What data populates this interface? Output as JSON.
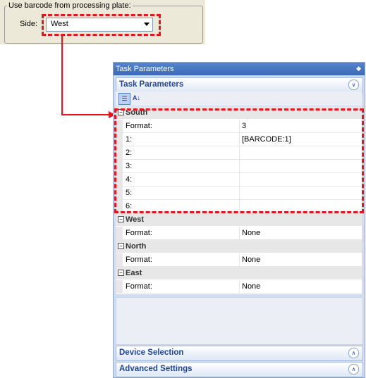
{
  "group": {
    "legend": "Use barcode from processing plate:",
    "side_label": "Side:",
    "side_value": "West"
  },
  "panel": {
    "title": "Task Parameters",
    "pin_icon": "pin-icon",
    "sections": {
      "task_parameters": "Task Parameters",
      "device_selection": "Device Selection",
      "advanced_settings": "Advanced Settings"
    },
    "toolbar": {
      "categorized_icon": "categorized-icon",
      "alphabetical_icon": "sort-alpha-icon"
    },
    "grid": {
      "categories": [
        {
          "name": "South",
          "rows": [
            {
              "key": "Format:",
              "value": "3"
            },
            {
              "key": "1:",
              "value": "[BARCODE:1]"
            },
            {
              "key": "2:",
              "value": ""
            },
            {
              "key": "3:",
              "value": ""
            },
            {
              "key": "4:",
              "value": ""
            },
            {
              "key": "5:",
              "value": ""
            },
            {
              "key": "6:",
              "value": ""
            }
          ]
        },
        {
          "name": "West",
          "rows": [
            {
              "key": "Format:",
              "value": "None"
            }
          ]
        },
        {
          "name": "North",
          "rows": [
            {
              "key": "Format:",
              "value": "None"
            }
          ]
        },
        {
          "name": "East",
          "rows": [
            {
              "key": "Format:",
              "value": "None"
            }
          ]
        }
      ]
    }
  },
  "colors": {
    "highlight": "#e8131d",
    "title_bar": "#3d6ab8",
    "section_text": "#21459c"
  }
}
